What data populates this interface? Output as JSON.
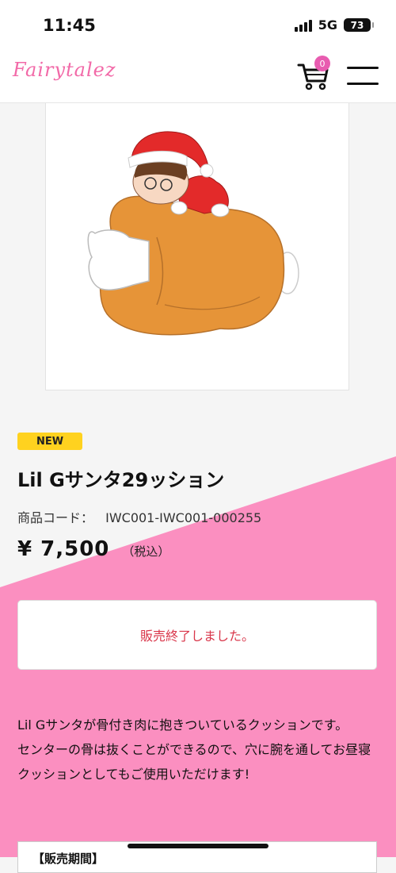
{
  "status_bar": {
    "time": "11:45",
    "network": "5G",
    "battery": "73"
  },
  "header": {
    "logo": "Fairytalez",
    "cart_count": "0",
    "cart_icon": "cart-icon",
    "menu_icon": "hamburger-menu-icon"
  },
  "product": {
    "badge": "NEW",
    "title": "Lil Gサンタ29ッション",
    "code_label": "商品コード：",
    "code_value": "IWC001-IWC001-000255",
    "price": "¥ 7,500",
    "tax_note": "（税込）",
    "status": "販売終了しました。",
    "description": [
      "Lil Gサンタが骨付き肉に抱きついているクッションです。",
      "センターの骨は抜くことができるので、穴に腕を通してお昼寝クッションとしてもご使用いただけます!"
    ],
    "period_label": "【販売期間】"
  },
  "colors": {
    "accent_pink": "#fb8fc0",
    "logo_pink": "#f26aa8",
    "badge_yellow": "#ffd21f",
    "sold_out_red": "#d9364a"
  }
}
